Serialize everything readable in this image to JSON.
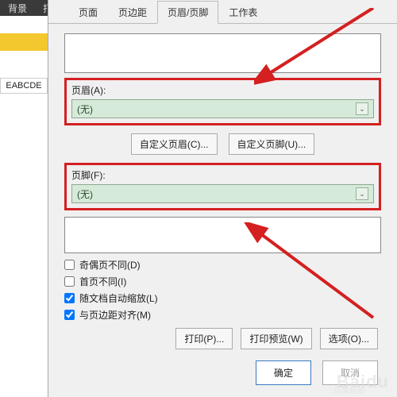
{
  "topbar": {
    "bg": "背景",
    "print_title": "打印标"
  },
  "sheet": {
    "cellA": "EABCDE"
  },
  "tabs": {
    "page": "页面",
    "margins": "页边距",
    "header_footer": "页眉/页脚",
    "worksheet": "工作表"
  },
  "header": {
    "label": "页眉(A):",
    "value": "(无)"
  },
  "footer": {
    "label": "页脚(F):",
    "value": "(无)"
  },
  "buttons": {
    "custom_header": "自定义页眉(C)...",
    "custom_footer": "自定义页脚(U)...",
    "print": "打印(P)...",
    "preview": "打印预览(W)",
    "options": "选项(O)...",
    "ok": "确定",
    "cancel": "取消"
  },
  "checks": {
    "odd_even": "奇偶页不同(D)",
    "first_page": "首页不同(I)",
    "scale_doc": "随文档自动缩放(L)",
    "align_margins": "与页边距对齐(M)"
  },
  "watermark": {
    "logo": "百度经验"
  }
}
